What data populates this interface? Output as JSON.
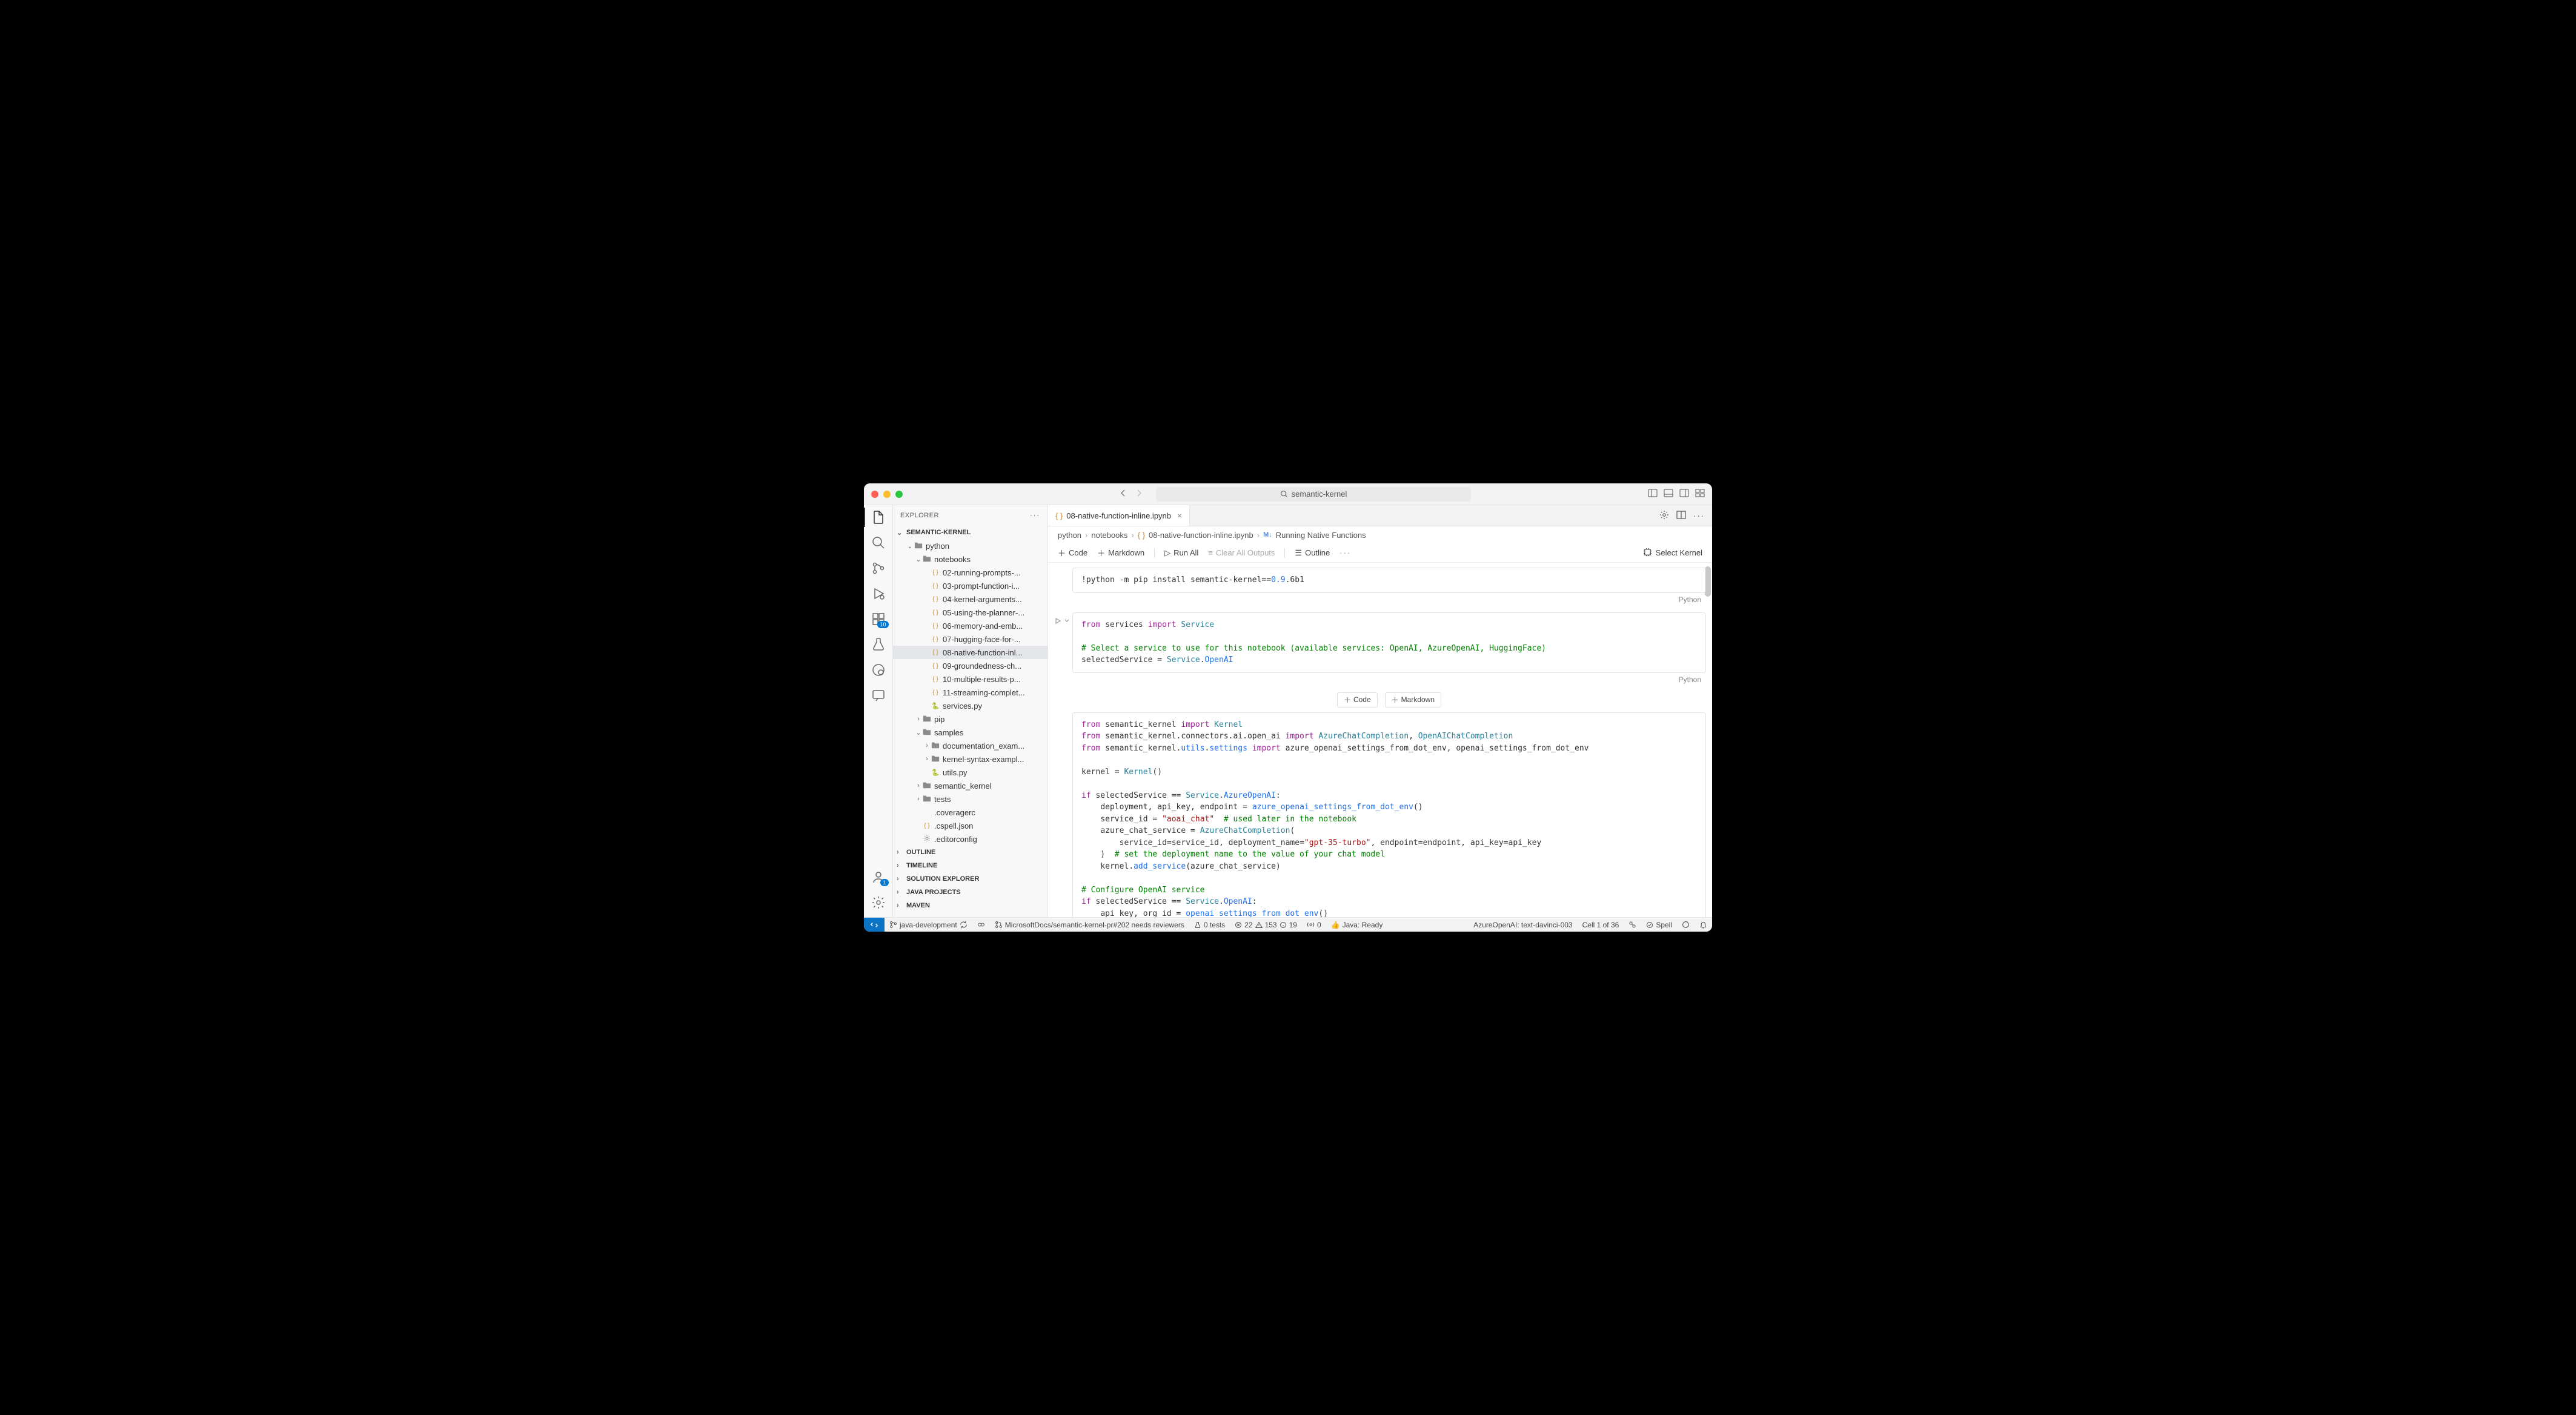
{
  "title": "semantic-kernel",
  "sidebar": {
    "header": "EXPLORER",
    "root": "SEMANTIC-KERNEL",
    "tree": [
      {
        "type": "folder",
        "label": "python",
        "depth": 1,
        "expanded": true
      },
      {
        "type": "folder",
        "label": "notebooks",
        "depth": 2,
        "expanded": true
      },
      {
        "type": "json",
        "label": "02-running-prompts-...",
        "depth": 3
      },
      {
        "type": "json",
        "label": "03-prompt-function-i...",
        "depth": 3
      },
      {
        "type": "json",
        "label": "04-kernel-arguments...",
        "depth": 3
      },
      {
        "type": "json",
        "label": "05-using-the-planner-...",
        "depth": 3
      },
      {
        "type": "json",
        "label": "06-memory-and-emb...",
        "depth": 3
      },
      {
        "type": "json",
        "label": "07-hugging-face-for-...",
        "depth": 3
      },
      {
        "type": "json",
        "label": "08-native-function-inl...",
        "depth": 3,
        "active": true
      },
      {
        "type": "json",
        "label": "09-groundedness-ch...",
        "depth": 3
      },
      {
        "type": "json",
        "label": "10-multiple-results-p...",
        "depth": 3
      },
      {
        "type": "json",
        "label": "11-streaming-complet...",
        "depth": 3
      },
      {
        "type": "py",
        "label": "services.py",
        "depth": 3
      },
      {
        "type": "folder",
        "label": "pip",
        "depth": 2,
        "expanded": false
      },
      {
        "type": "folder",
        "label": "samples",
        "depth": 2,
        "expanded": true
      },
      {
        "type": "folder",
        "label": "documentation_exam...",
        "depth": 3,
        "expanded": false
      },
      {
        "type": "folder",
        "label": "kernel-syntax-exampl...",
        "depth": 3,
        "expanded": false
      },
      {
        "type": "py",
        "label": "utils.py",
        "depth": 3
      },
      {
        "type": "folder",
        "label": "semantic_kernel",
        "depth": 2,
        "expanded": false
      },
      {
        "type": "folder",
        "label": "tests",
        "depth": 2,
        "expanded": false
      },
      {
        "type": "file",
        "label": ".coveragerc",
        "depth": 2
      },
      {
        "type": "json",
        "label": ".cspell.json",
        "depth": 2
      },
      {
        "type": "cfg",
        "label": ".editorconfig",
        "depth": 2
      }
    ],
    "sections": [
      "OUTLINE",
      "TIMELINE",
      "SOLUTION EXPLORER",
      "JAVA PROJECTS",
      "MAVEN"
    ]
  },
  "tab": {
    "label": "08-native-function-inline.ipynb"
  },
  "breadcrumbs": {
    "parts": [
      "python",
      "notebooks",
      "08-native-function-inline.ipynb",
      "Running Native Functions"
    ]
  },
  "nb_toolbar": {
    "code": "Code",
    "markdown": "Markdown",
    "run_all": "Run All",
    "clear": "Clear All Outputs",
    "outline": "Outline",
    "kernel": "Select Kernel"
  },
  "insert": {
    "code": "Code",
    "markdown": "Markdown"
  },
  "cell_lang": "Python",
  "activity_badges": {
    "extensions": "10",
    "accounts": "1"
  },
  "status": {
    "branch": "java-development",
    "pr": "MicrosoftDocs/semantic-kernel-pr#202 needs reviewers",
    "tests": "0 tests",
    "errors": "22",
    "warnings": "153",
    "info": "19",
    "ports": "0",
    "java": "Java: Ready",
    "azure": "AzureOpenAI: text-davinci-003",
    "cell": "Cell 1 of 36",
    "spell": "Spell"
  }
}
